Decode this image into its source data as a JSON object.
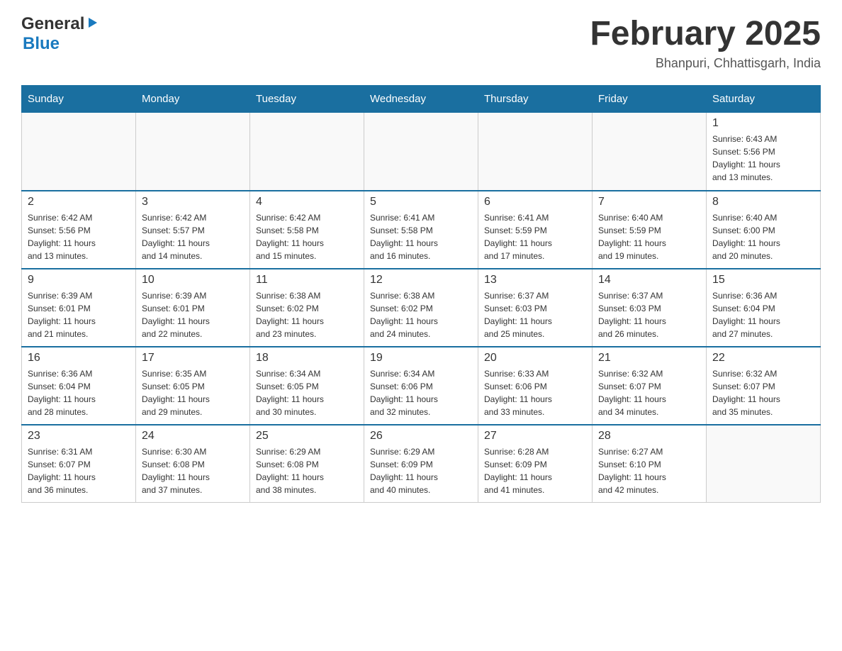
{
  "header": {
    "logo_general": "General",
    "logo_blue": "Blue",
    "month_year": "February 2025",
    "location": "Bhanpuri, Chhattisgarh, India"
  },
  "weekdays": [
    "Sunday",
    "Monday",
    "Tuesday",
    "Wednesday",
    "Thursday",
    "Friday",
    "Saturday"
  ],
  "weeks": [
    [
      {
        "day": "",
        "info": ""
      },
      {
        "day": "",
        "info": ""
      },
      {
        "day": "",
        "info": ""
      },
      {
        "day": "",
        "info": ""
      },
      {
        "day": "",
        "info": ""
      },
      {
        "day": "",
        "info": ""
      },
      {
        "day": "1",
        "info": "Sunrise: 6:43 AM\nSunset: 5:56 PM\nDaylight: 11 hours\nand 13 minutes."
      }
    ],
    [
      {
        "day": "2",
        "info": "Sunrise: 6:42 AM\nSunset: 5:56 PM\nDaylight: 11 hours\nand 13 minutes."
      },
      {
        "day": "3",
        "info": "Sunrise: 6:42 AM\nSunset: 5:57 PM\nDaylight: 11 hours\nand 14 minutes."
      },
      {
        "day": "4",
        "info": "Sunrise: 6:42 AM\nSunset: 5:58 PM\nDaylight: 11 hours\nand 15 minutes."
      },
      {
        "day": "5",
        "info": "Sunrise: 6:41 AM\nSunset: 5:58 PM\nDaylight: 11 hours\nand 16 minutes."
      },
      {
        "day": "6",
        "info": "Sunrise: 6:41 AM\nSunset: 5:59 PM\nDaylight: 11 hours\nand 17 minutes."
      },
      {
        "day": "7",
        "info": "Sunrise: 6:40 AM\nSunset: 5:59 PM\nDaylight: 11 hours\nand 19 minutes."
      },
      {
        "day": "8",
        "info": "Sunrise: 6:40 AM\nSunset: 6:00 PM\nDaylight: 11 hours\nand 20 minutes."
      }
    ],
    [
      {
        "day": "9",
        "info": "Sunrise: 6:39 AM\nSunset: 6:01 PM\nDaylight: 11 hours\nand 21 minutes."
      },
      {
        "day": "10",
        "info": "Sunrise: 6:39 AM\nSunset: 6:01 PM\nDaylight: 11 hours\nand 22 minutes."
      },
      {
        "day": "11",
        "info": "Sunrise: 6:38 AM\nSunset: 6:02 PM\nDaylight: 11 hours\nand 23 minutes."
      },
      {
        "day": "12",
        "info": "Sunrise: 6:38 AM\nSunset: 6:02 PM\nDaylight: 11 hours\nand 24 minutes."
      },
      {
        "day": "13",
        "info": "Sunrise: 6:37 AM\nSunset: 6:03 PM\nDaylight: 11 hours\nand 25 minutes."
      },
      {
        "day": "14",
        "info": "Sunrise: 6:37 AM\nSunset: 6:03 PM\nDaylight: 11 hours\nand 26 minutes."
      },
      {
        "day": "15",
        "info": "Sunrise: 6:36 AM\nSunset: 6:04 PM\nDaylight: 11 hours\nand 27 minutes."
      }
    ],
    [
      {
        "day": "16",
        "info": "Sunrise: 6:36 AM\nSunset: 6:04 PM\nDaylight: 11 hours\nand 28 minutes."
      },
      {
        "day": "17",
        "info": "Sunrise: 6:35 AM\nSunset: 6:05 PM\nDaylight: 11 hours\nand 29 minutes."
      },
      {
        "day": "18",
        "info": "Sunrise: 6:34 AM\nSunset: 6:05 PM\nDaylight: 11 hours\nand 30 minutes."
      },
      {
        "day": "19",
        "info": "Sunrise: 6:34 AM\nSunset: 6:06 PM\nDaylight: 11 hours\nand 32 minutes."
      },
      {
        "day": "20",
        "info": "Sunrise: 6:33 AM\nSunset: 6:06 PM\nDaylight: 11 hours\nand 33 minutes."
      },
      {
        "day": "21",
        "info": "Sunrise: 6:32 AM\nSunset: 6:07 PM\nDaylight: 11 hours\nand 34 minutes."
      },
      {
        "day": "22",
        "info": "Sunrise: 6:32 AM\nSunset: 6:07 PM\nDaylight: 11 hours\nand 35 minutes."
      }
    ],
    [
      {
        "day": "23",
        "info": "Sunrise: 6:31 AM\nSunset: 6:07 PM\nDaylight: 11 hours\nand 36 minutes."
      },
      {
        "day": "24",
        "info": "Sunrise: 6:30 AM\nSunset: 6:08 PM\nDaylight: 11 hours\nand 37 minutes."
      },
      {
        "day": "25",
        "info": "Sunrise: 6:29 AM\nSunset: 6:08 PM\nDaylight: 11 hours\nand 38 minutes."
      },
      {
        "day": "26",
        "info": "Sunrise: 6:29 AM\nSunset: 6:09 PM\nDaylight: 11 hours\nand 40 minutes."
      },
      {
        "day": "27",
        "info": "Sunrise: 6:28 AM\nSunset: 6:09 PM\nDaylight: 11 hours\nand 41 minutes."
      },
      {
        "day": "28",
        "info": "Sunrise: 6:27 AM\nSunset: 6:10 PM\nDaylight: 11 hours\nand 42 minutes."
      },
      {
        "day": "",
        "info": ""
      }
    ]
  ]
}
